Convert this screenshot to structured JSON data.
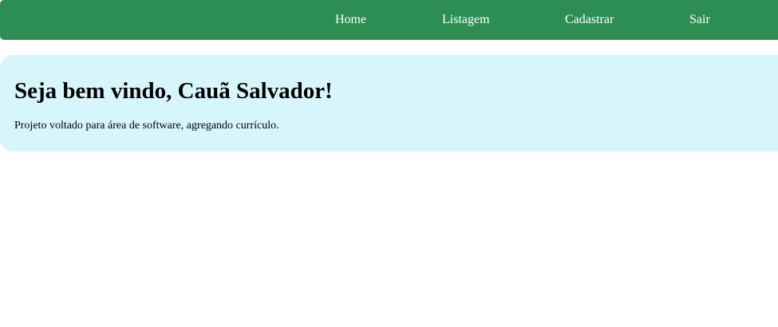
{
  "nav": {
    "items": [
      {
        "label": "Home"
      },
      {
        "label": "Listagem"
      },
      {
        "label": "Cadastrar"
      },
      {
        "label": "Sair"
      }
    ]
  },
  "welcome": {
    "title": "Seja bem vindo, Cauã Salvador!",
    "description": "Projeto voltado para área de software, agregando currículo."
  },
  "colors": {
    "navbar": "#2c8e52",
    "panel": "#d7f6fc",
    "nav_text": "#ffffff"
  }
}
